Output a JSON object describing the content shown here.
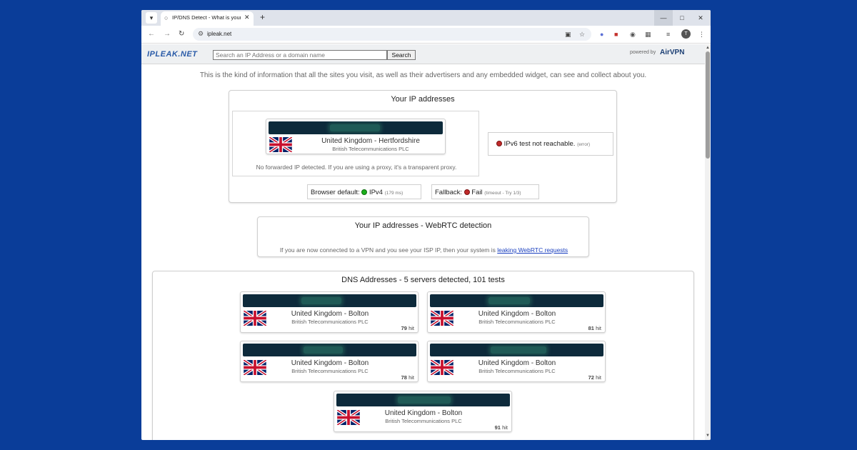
{
  "browser": {
    "tab_title": "IP/DNS Detect - What is your IP",
    "url": "ipleak.net",
    "profile_initial": "T"
  },
  "site": {
    "logo": "IPLEAK.NET",
    "search_placeholder": "Search an IP Address or a domain name",
    "search_button": "Search",
    "powered_by": "powered by",
    "brand": "AirVPN"
  },
  "intro": "This is the kind of information that all the sites you visit, as well as their advertisers and any embedded widget, can see and collect about you.",
  "ip_section": {
    "title": "Your IP addresses",
    "card": {
      "location": "United Kingdom - Hertfordshire",
      "isp": "British Telecommunications PLC"
    },
    "proxy_note": "No forwarded IP detected. If you are using a proxy, it's a transparent proxy.",
    "ipv6_text": "IPv6 test not reachable.",
    "ipv6_small": "(error)",
    "browser_default_label": "Browser default:",
    "browser_default_value": "IPv4",
    "browser_default_small": "(179 ms)",
    "fallback_label": "Fallback:",
    "fallback_value": "Fail",
    "fallback_small": "(timeout - Try 1/3)"
  },
  "webrtc_section": {
    "title": "Your IP addresses - WebRTC detection",
    "note": "If you are now connected to a VPN and you see your ISP IP, then your system is",
    "link": "leaking WebRTC requests"
  },
  "dns_section": {
    "title": "DNS Addresses - 5 servers detected, 101 tests",
    "hit_suffix": "hit",
    "servers": [
      {
        "location": "United Kingdom - Bolton",
        "isp": "British Telecommunications PLC",
        "hits": "79"
      },
      {
        "location": "United Kingdom - Bolton",
        "isp": "British Telecommunications PLC",
        "hits": "81"
      },
      {
        "location": "United Kingdom - Bolton",
        "isp": "British Telecommunications PLC",
        "hits": "78"
      },
      {
        "location": "United Kingdom - Bolton",
        "isp": "British Telecommunications PLC",
        "hits": "72"
      },
      {
        "location": "United Kingdom - Bolton",
        "isp": "British Telecommunications PLC",
        "hits": "91"
      }
    ]
  }
}
